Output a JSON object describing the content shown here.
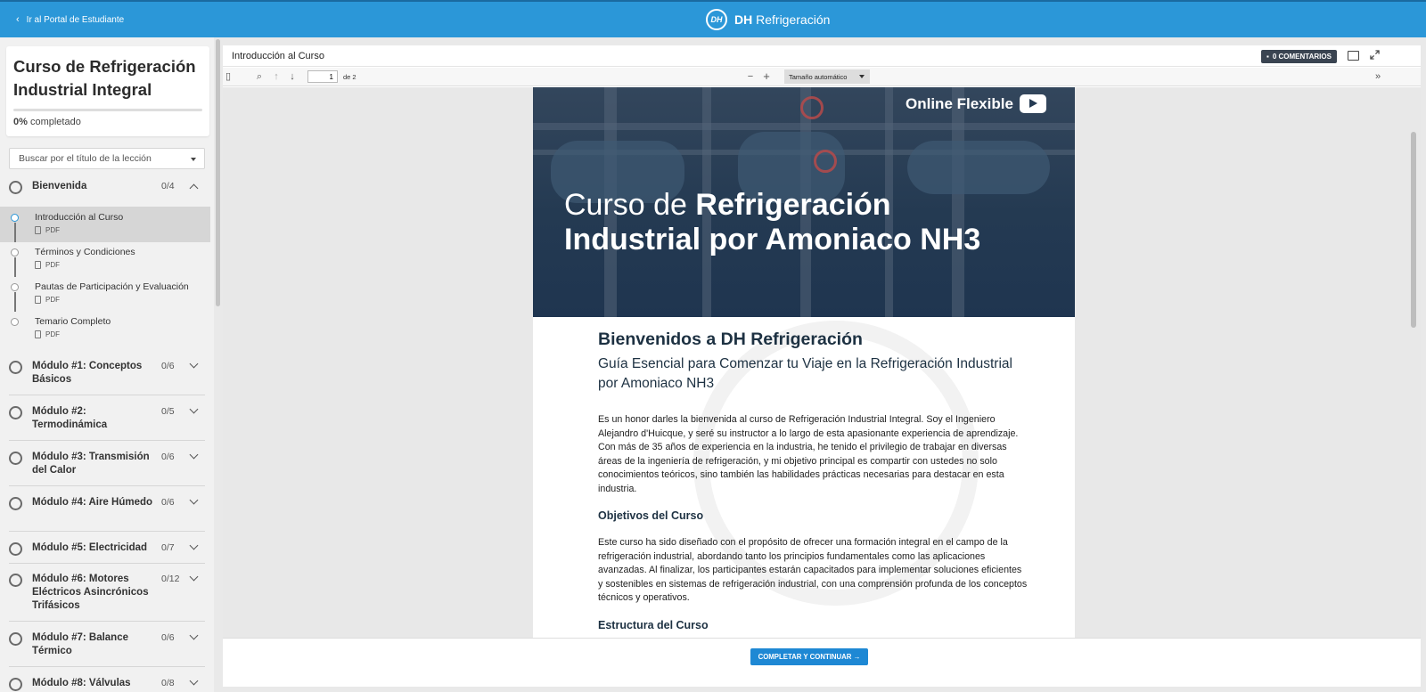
{
  "topbar": {
    "back_label": "Ir al Portal de Estudiante",
    "logo_mark": "DH",
    "brand_bold": "DH",
    "brand_rest": "Refrigeración",
    "color": "#2b97d8"
  },
  "sidebar": {
    "course_title": "Curso de Refrigeración Industrial Integral",
    "progress_percent": "0%",
    "progress_suffix": "completado",
    "progress_value": 0,
    "search_placeholder": "Buscar por el título de la lección",
    "modules": [
      {
        "name": "Bienvenida",
        "count": "0/4",
        "expanded": true
      },
      {
        "name": "Módulo #1: Conceptos Básicos",
        "count": "0/6"
      },
      {
        "name": "Módulo #2: Termodinámica",
        "count": "0/5"
      },
      {
        "name": "Módulo #3: Transmisión del Calor",
        "count": "0/6"
      },
      {
        "name": "Módulo #4: Aire Húmedo",
        "count": "0/6"
      },
      {
        "name": "Módulo #5: Electricidad",
        "count": "0/7"
      },
      {
        "name": "Módulo #6: Motores Eléctricos Asincrónicos Trifásicos",
        "count": "0/12"
      },
      {
        "name": "Módulo #7: Balance Térmico",
        "count": "0/6"
      },
      {
        "name": "Módulo #8: Válvulas",
        "count": "0/8"
      }
    ],
    "lessons": [
      {
        "title": "Introducción al Curso",
        "type": "PDF",
        "active": true
      },
      {
        "title": "Términos y Condiciones",
        "type": "PDF"
      },
      {
        "title": "Pautas de Participación y Evaluación",
        "type": "PDF"
      },
      {
        "title": "Temario Completo",
        "type": "PDF"
      }
    ]
  },
  "viewer": {
    "title": "Introducción al Curso",
    "comments_label": "0 COMENTARIOS",
    "toolbar": {
      "page_current": "1",
      "page_of": "de 2",
      "zoom": "Tamaño automático"
    },
    "document": {
      "hero_badge": "Online Flexible",
      "hero_title_plain": "Curso de ",
      "hero_title_bold": "Refrigeración Industrial por Amoniaco NH3",
      "heading": "Bienvenidos a DH Refrigeración",
      "subheading": "Guía Esencial para Comenzar tu Viaje en la Refrigeración Industrial por Amoniaco NH3",
      "intro": "Es un honor darles la bienvenida al curso de Refrigeración Industrial Integral. Soy el Ingeniero Alejandro d'Huicque, y seré su instructor a lo largo de esta apasionante experiencia de aprendizaje. Con más de 35 años de experiencia en la industria, he tenido el privilegio de trabajar en diversas áreas de la ingeniería de refrigeración, y mi objetivo principal es compartir con ustedes no solo conocimientos teóricos, sino también las habilidades prácticas necesarias para destacar en esta industria.",
      "objectives_heading": "Objetivos del Curso",
      "objectives_text": "Este curso ha sido diseñado con el propósito de ofrecer una formación integral en el campo de la refrigeración industrial, abordando tanto los principios fundamentales como las aplicaciones avanzadas. Al finalizar, los participantes estarán capacitados para implementar soluciones eficientes y sostenibles en sistemas de refrigeración industrial, con una comprensión profunda de los conceptos técnicos y operativos.",
      "structure_heading": "Estructura del Curso"
    },
    "continue_label": "COMPLETAR Y CONTINUAR →"
  }
}
